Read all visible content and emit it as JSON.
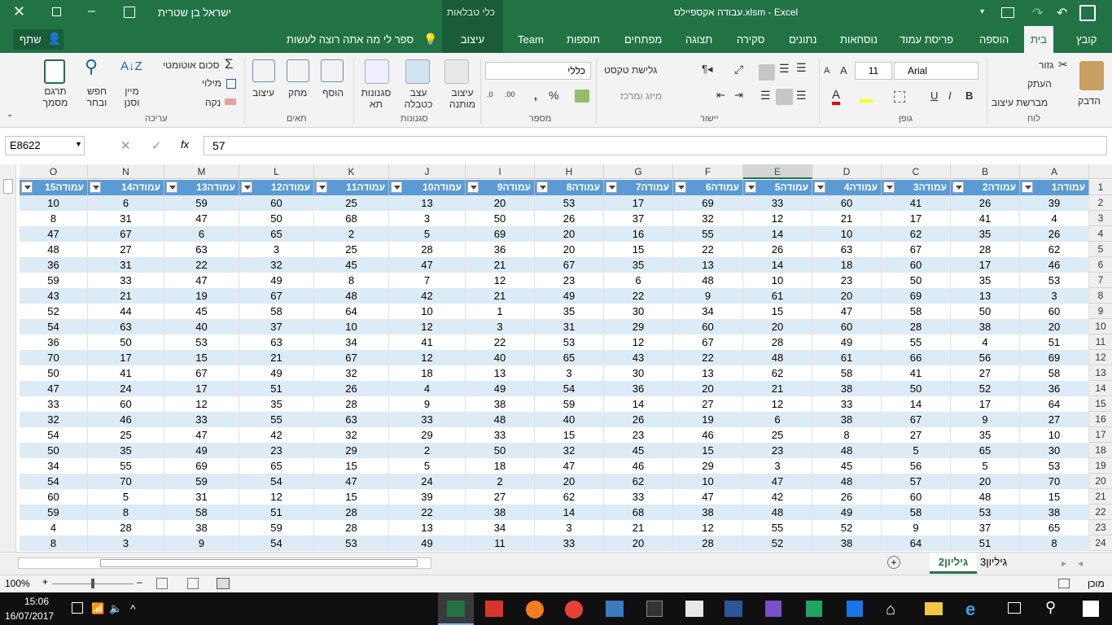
{
  "title_bar": {
    "workbook_title": "עבודה אקספיילס.xlsm - Excel",
    "tools_title": "כלי טבלאות",
    "user_name": "ישראל בן שטרית"
  },
  "tabs": [
    "קובץ",
    "בית",
    "הוספה",
    "פריסת עמוד",
    "נוסחאות",
    "נתונים",
    "סקירה",
    "תצוגה",
    "מפתחים",
    "תוספות",
    "Team",
    "עיצוב"
  ],
  "tell_me": "ספר לי מה אתה רוצה לעשות",
  "share": "שתף",
  "ribbon": {
    "clipboard": {
      "paste": "הדבק",
      "cut": "גזור",
      "copy": "העתק",
      "format_painter": "מברשת עיצוב",
      "group": "לוח"
    },
    "font": {
      "name": "Arial",
      "size": "11",
      "group": "גופן",
      "bold": "B",
      "italic": "I",
      "underline": "U"
    },
    "alignment": {
      "wrap": "גלישת טקסט",
      "merge": "מיזג ומרכז",
      "group": "יישור"
    },
    "number": {
      "format": "כללי",
      "group": "מספר",
      "percent": "%",
      "comma": ","
    },
    "styles": {
      "conditional": "עיצוב מותנה",
      "as_table": "עצב כטבלה",
      "cell_styles": "סגנונות תא",
      "group": "סגנונות"
    },
    "cells": {
      "insert": "הוסף",
      "delete": "מחק",
      "format": "עיצוב",
      "group": "תאים"
    },
    "editing": {
      "autosum": "סכום אוטומטי",
      "fill": "מילוי",
      "clear": "נקה",
      "sort": "מיין וסנן",
      "find": "חפש ובחר",
      "translate": "תרגם מסמך",
      "group": "עריכה"
    }
  },
  "formula_bar": {
    "name_box": "E8622",
    "value": "57",
    "fx": "fx"
  },
  "columns": [
    "A",
    "B",
    "C",
    "D",
    "E",
    "F",
    "G",
    "H",
    "I",
    "J",
    "K",
    "L",
    "M",
    "N",
    "O"
  ],
  "selected_column": "E",
  "headers": [
    "עמודה1",
    "עמודה2",
    "עמודה3",
    "עמודה4",
    "עמודה5",
    "עמודה6",
    "עמודה7",
    "עמודה8",
    "עמודה9",
    "עמודה10",
    "עמודה11",
    "עמודה12",
    "עמודה13",
    "עמודה14",
    "עמודה15"
  ],
  "row_numbers": [
    "1",
    "2",
    "3",
    "4",
    "5",
    "6",
    "7",
    "8",
    "9",
    "10",
    "11",
    "12",
    "13",
    "14",
    "15",
    "16",
    "17",
    "18",
    "19",
    "20",
    "21",
    "22",
    "23",
    "24"
  ],
  "rows": [
    [
      "39",
      "26",
      "41",
      "60",
      "33",
      "69",
      "17",
      "53",
      "20",
      "13",
      "25",
      "60",
      "59",
      "6",
      "10"
    ],
    [
      "4",
      "41",
      "17",
      "21",
      "12",
      "32",
      "37",
      "26",
      "50",
      "3",
      "68",
      "50",
      "47",
      "31",
      "8"
    ],
    [
      "26",
      "35",
      "62",
      "10",
      "14",
      "55",
      "16",
      "20",
      "69",
      "5",
      "2",
      "65",
      "6",
      "67",
      "47"
    ],
    [
      "62",
      "28",
      "67",
      "63",
      "26",
      "22",
      "15",
      "20",
      "36",
      "28",
      "25",
      "3",
      "63",
      "27",
      "48"
    ],
    [
      "46",
      "17",
      "60",
      "18",
      "14",
      "13",
      "35",
      "67",
      "21",
      "47",
      "45",
      "32",
      "22",
      "31",
      "36"
    ],
    [
      "53",
      "35",
      "50",
      "23",
      "10",
      "48",
      "6",
      "23",
      "12",
      "7",
      "8",
      "49",
      "47",
      "33",
      "59"
    ],
    [
      "3",
      "13",
      "69",
      "20",
      "61",
      "9",
      "22",
      "49",
      "21",
      "42",
      "48",
      "67",
      "19",
      "21",
      "43"
    ],
    [
      "60",
      "50",
      "58",
      "47",
      "15",
      "34",
      "30",
      "35",
      "1",
      "10",
      "64",
      "58",
      "45",
      "44",
      "52"
    ],
    [
      "20",
      "38",
      "28",
      "60",
      "20",
      "60",
      "29",
      "31",
      "3",
      "12",
      "10",
      "37",
      "40",
      "63",
      "54"
    ],
    [
      "51",
      "4",
      "55",
      "49",
      "28",
      "67",
      "12",
      "53",
      "22",
      "41",
      "34",
      "63",
      "53",
      "50",
      "36"
    ],
    [
      "69",
      "56",
      "66",
      "61",
      "48",
      "22",
      "43",
      "65",
      "40",
      "12",
      "67",
      "21",
      "15",
      "17",
      "70"
    ],
    [
      "58",
      "27",
      "41",
      "58",
      "62",
      "13",
      "30",
      "3",
      "13",
      "18",
      "32",
      "49",
      "67",
      "41",
      "50"
    ],
    [
      "36",
      "52",
      "50",
      "38",
      "21",
      "20",
      "36",
      "54",
      "49",
      "4",
      "26",
      "51",
      "17",
      "24",
      "47"
    ],
    [
      "64",
      "17",
      "14",
      "33",
      "12",
      "27",
      "14",
      "59",
      "38",
      "9",
      "28",
      "35",
      "12",
      "60",
      "33"
    ],
    [
      "27",
      "9",
      "67",
      "38",
      "6",
      "19",
      "26",
      "40",
      "48",
      "33",
      "63",
      "55",
      "33",
      "46",
      "32"
    ],
    [
      "10",
      "35",
      "27",
      "8",
      "25",
      "46",
      "23",
      "15",
      "33",
      "29",
      "32",
      "42",
      "47",
      "25",
      "54"
    ],
    [
      "30",
      "65",
      "5",
      "48",
      "23",
      "15",
      "45",
      "32",
      "50",
      "2",
      "29",
      "23",
      "49",
      "35",
      "50"
    ],
    [
      "53",
      "5",
      "56",
      "45",
      "3",
      "29",
      "46",
      "47",
      "18",
      "5",
      "15",
      "65",
      "69",
      "55",
      "34"
    ],
    [
      "70",
      "20",
      "57",
      "48",
      "47",
      "10",
      "62",
      "20",
      "2",
      "24",
      "47",
      "54",
      "59",
      "70",
      "54"
    ],
    [
      "15",
      "48",
      "60",
      "26",
      "42",
      "47",
      "33",
      "62",
      "27",
      "39",
      "15",
      "12",
      "31",
      "5",
      "60"
    ],
    [
      "38",
      "53",
      "58",
      "49",
      "48",
      "38",
      "68",
      "14",
      "38",
      "22",
      "28",
      "51",
      "58",
      "8",
      "59"
    ],
    [
      "65",
      "37",
      "9",
      "52",
      "55",
      "12",
      "21",
      "3",
      "34",
      "13",
      "28",
      "59",
      "38",
      "28",
      "4"
    ],
    [
      "8",
      "51",
      "64",
      "38",
      "52",
      "28",
      "20",
      "33",
      "11",
      "49",
      "53",
      "54",
      "9",
      "3",
      "8"
    ]
  ],
  "sheets": [
    {
      "name": "גיליון2",
      "active": true
    },
    {
      "name": "גיליון3",
      "active": false
    }
  ],
  "status": {
    "ready": "מוכן",
    "zoom": "100%"
  },
  "clock": {
    "time": "15:06",
    "date": "16/07/2017"
  },
  "colors": {
    "accent": "#217346",
    "table_header": "#5b9bd5",
    "band": "#ddebf7"
  }
}
